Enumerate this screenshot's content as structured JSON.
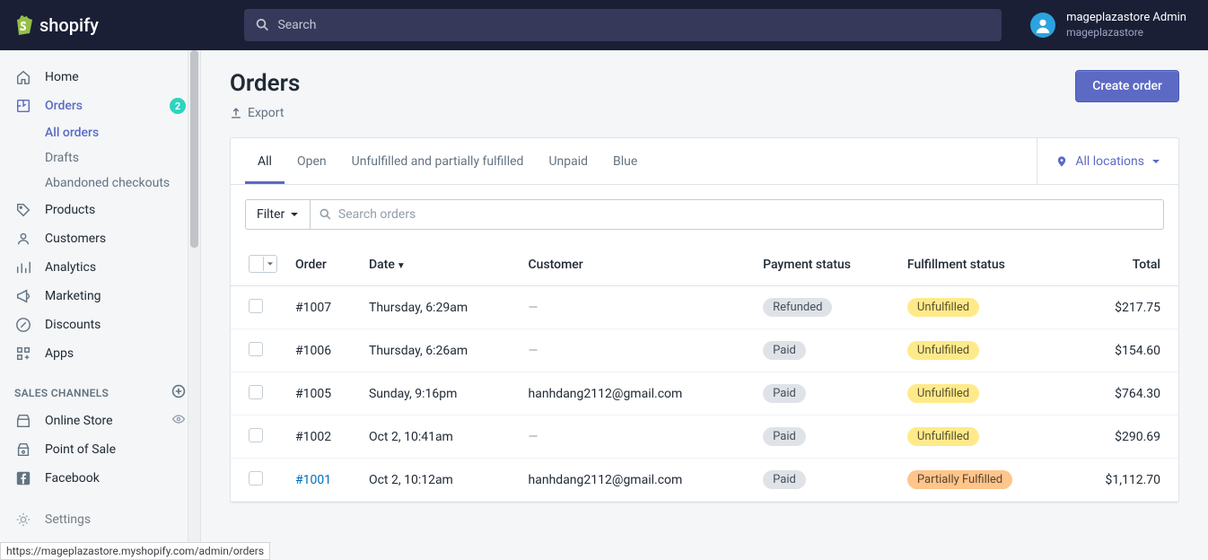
{
  "brand": "shopify",
  "search_placeholder": "Search",
  "user": {
    "name": "mageplazastore Admin",
    "store": "mageplazastore"
  },
  "sidebar": {
    "items": [
      {
        "label": "Home",
        "icon": "home"
      },
      {
        "label": "Orders",
        "icon": "orders",
        "active": true,
        "badge": "2"
      },
      {
        "label": "Products",
        "icon": "products"
      },
      {
        "label": "Customers",
        "icon": "customers"
      },
      {
        "label": "Analytics",
        "icon": "analytics"
      },
      {
        "label": "Marketing",
        "icon": "marketing"
      },
      {
        "label": "Discounts",
        "icon": "discounts"
      },
      {
        "label": "Apps",
        "icon": "apps"
      }
    ],
    "subnav": [
      {
        "label": "All orders",
        "active": true
      },
      {
        "label": "Drafts"
      },
      {
        "label": "Abandoned checkouts"
      }
    ],
    "channels_title": "SALES CHANNELS",
    "channels": [
      {
        "label": "Online Store",
        "icon": "store",
        "trail": "eye"
      },
      {
        "label": "Point of Sale",
        "icon": "pos"
      },
      {
        "label": "Facebook",
        "icon": "facebook"
      }
    ],
    "settings": "Settings"
  },
  "page": {
    "title": "Orders",
    "export": "Export",
    "create": "Create order",
    "tabs": [
      "All",
      "Open",
      "Unfulfilled and partially fulfilled",
      "Unpaid",
      "Blue"
    ],
    "locations": "All locations",
    "filter": "Filter",
    "search_orders_placeholder": "Search orders",
    "columns": [
      "Order",
      "Date",
      "Customer",
      "Payment status",
      "Fulfillment status",
      "Total"
    ]
  },
  "orders": [
    {
      "id": "#1007",
      "date": "Thursday, 6:29am",
      "customer": "—",
      "payment": "Refunded",
      "payClass": "gray",
      "fulfill": "Unfulfilled",
      "fulClass": "yellow",
      "total": "$217.75"
    },
    {
      "id": "#1006",
      "date": "Thursday, 6:26am",
      "customer": "—",
      "payment": "Paid",
      "payClass": "gray",
      "fulfill": "Unfulfilled",
      "fulClass": "yellow",
      "total": "$154.60"
    },
    {
      "id": "#1005",
      "date": "Sunday, 9:16pm",
      "customer": "hanhdang2112@gmail.com",
      "payment": "Paid",
      "payClass": "gray",
      "fulfill": "Unfulfilled",
      "fulClass": "yellow",
      "total": "$764.30"
    },
    {
      "id": "#1002",
      "date": "Oct 2, 10:41am",
      "customer": "—",
      "payment": "Paid",
      "payClass": "gray",
      "fulfill": "Unfulfilled",
      "fulClass": "yellow",
      "total": "$290.69"
    },
    {
      "id": "#1001",
      "date": "Oct 2, 10:12am",
      "customer": "hanhdang2112@gmail.com",
      "payment": "Paid",
      "payClass": "gray",
      "fulfill": "Partially Fulfilled",
      "fulClass": "orange",
      "total": "$1,112.70",
      "link": true
    }
  ],
  "status_url": "https://mageplazastore.myshopify.com/admin/orders"
}
